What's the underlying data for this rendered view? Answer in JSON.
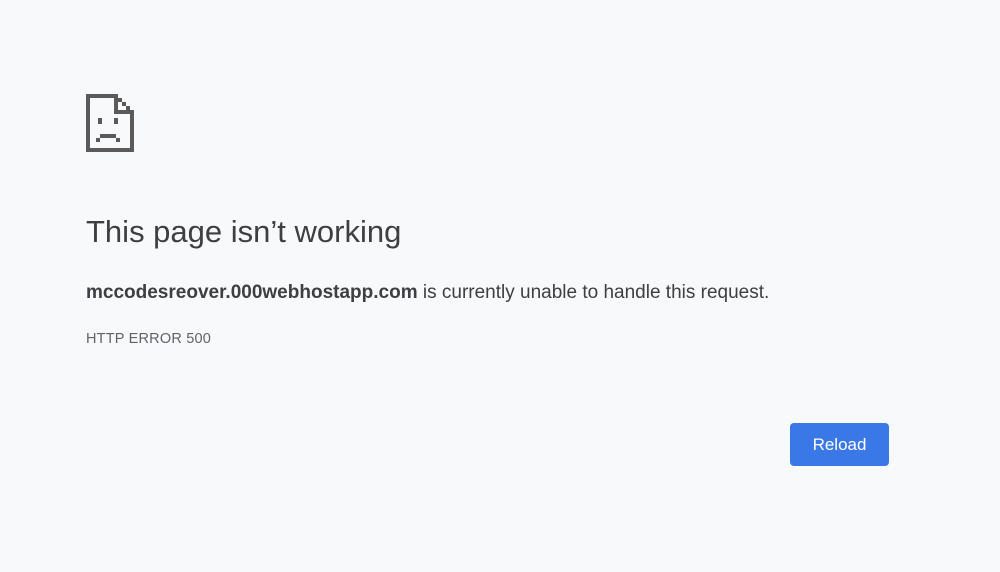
{
  "error": {
    "icon": "sad-page-icon",
    "title": "This page isn’t working",
    "host": "mccodesreover.000webhostapp.com",
    "summary_suffix": " is currently unable to handle this request.",
    "code": "HTTP ERROR 500"
  },
  "actions": {
    "reload_label": "Reload"
  },
  "colors": {
    "background": "#f8f9fa",
    "text": "#3c4043",
    "icon": "#5a5a5a",
    "button": "#3b78e7"
  }
}
